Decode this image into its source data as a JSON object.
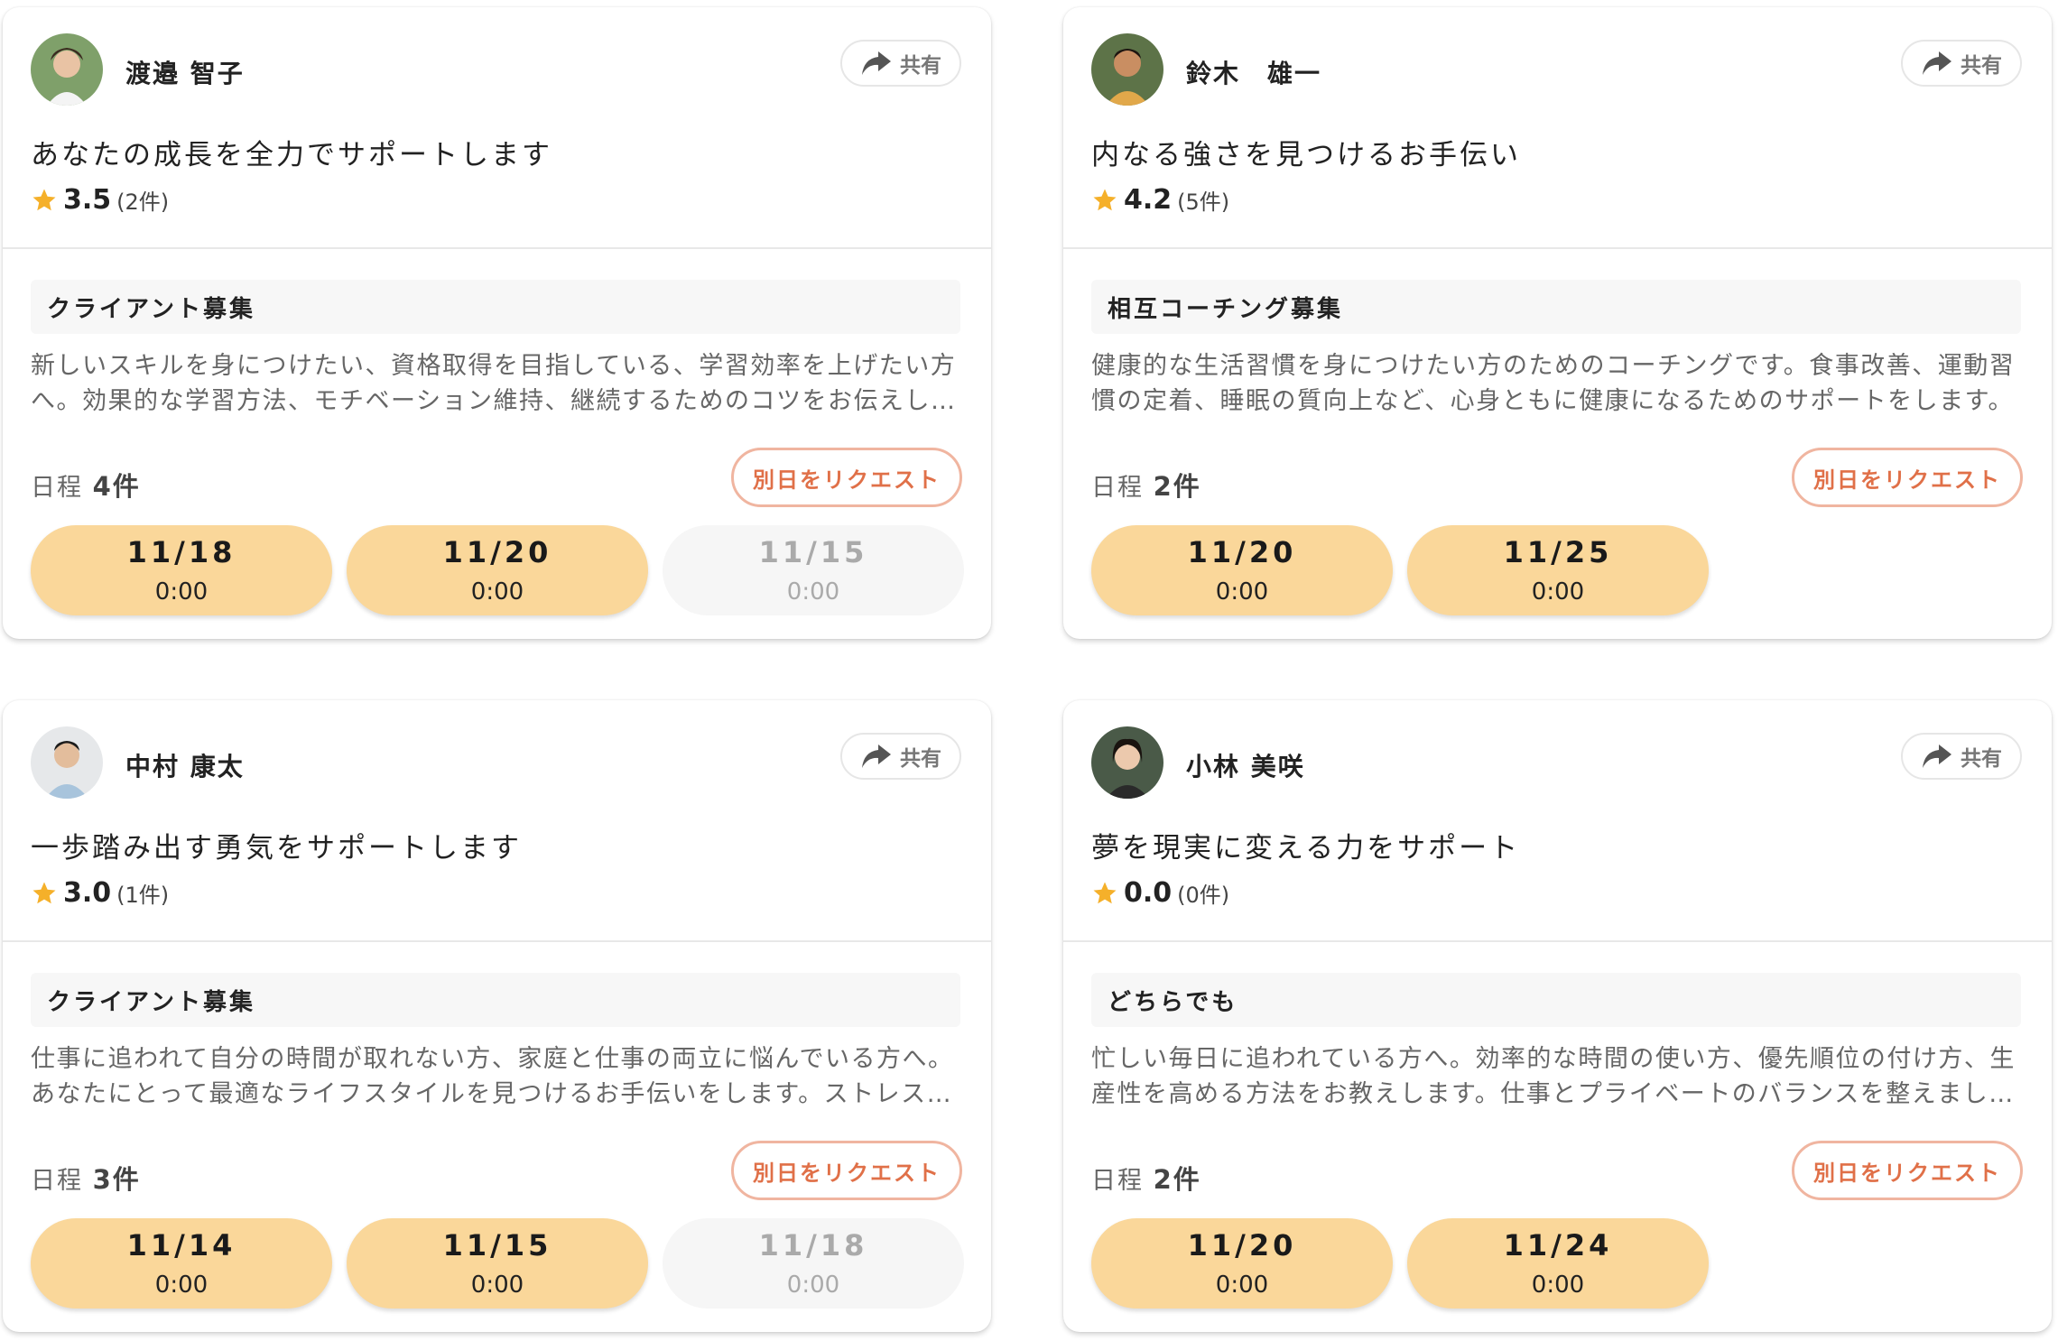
{
  "colors": {
    "slot_bg": "#fad79a",
    "slot_disabled_bg": "#f6f6f6",
    "request_accent": "#e07048",
    "star": "#f5b02a"
  },
  "cards": [
    {
      "name": "渡邉 智子",
      "share_label": "共有",
      "title": "あなたの成長を全力でサポートします",
      "rating": "3.5",
      "review_count": "(2件)",
      "category": "クライアント募集",
      "description": "新しいスキルを身につけたい、資格取得を目指している、学習効率を上げたい方へ。効果的な学習方法、モチベーション維持、継続するためのコツをお伝えします。",
      "schedule_prefix": "日程",
      "schedule_count": "4件",
      "request_label": "別日をリクエスト",
      "slots": [
        {
          "date": "11/18",
          "time": "0:00",
          "available": true
        },
        {
          "date": "11/20",
          "time": "0:00",
          "available": true
        },
        {
          "date": "11/15",
          "time": "0:00",
          "available": false
        }
      ]
    },
    {
      "name": "鈴木　雄一",
      "share_label": "共有",
      "title": "内なる強さを見つけるお手伝い",
      "rating": "4.2",
      "review_count": "(5件)",
      "category": "相互コーチング募集",
      "description": "健康的な生活習慣を身につけたい方のためのコーチングです。食事改善、運動習慣の定着、睡眠の質向上など、心身ともに健康になるためのサポートをします。",
      "schedule_prefix": "日程",
      "schedule_count": "2件",
      "request_label": "別日をリクエスト",
      "slots": [
        {
          "date": "11/20",
          "time": "0:00",
          "available": true
        },
        {
          "date": "11/25",
          "time": "0:00",
          "available": true
        }
      ]
    },
    {
      "name": "中村 康太",
      "share_label": "共有",
      "title": "一歩踏み出す勇気をサポートします",
      "rating": "3.0",
      "review_count": "(1件)",
      "category": "クライアント募集",
      "description": "仕事に追われて自分の時間が取れない方、家庭と仕事の両立に悩んでいる方へ。あなたにとって最適なライフスタイルを見つけるお手伝いをします。ストレスなく",
      "schedule_prefix": "日程",
      "schedule_count": "3件",
      "request_label": "別日をリクエスト",
      "slots": [
        {
          "date": "11/14",
          "time": "0:00",
          "available": true
        },
        {
          "date": "11/15",
          "time": "0:00",
          "available": true
        },
        {
          "date": "11/18",
          "time": "0:00",
          "available": false
        }
      ]
    },
    {
      "name": "小林 美咲",
      "share_label": "共有",
      "title": "夢を現実に変える力をサポート",
      "rating": "0.0",
      "review_count": "(0件)",
      "category": "どちらでも",
      "description": "忙しい毎日に追われている方へ。効率的な時間の使い方、優先順位の付け方、生産性を高める方法をお教えします。仕事とプライベートのバランスを整えましょう。",
      "schedule_prefix": "日程",
      "schedule_count": "2件",
      "request_label": "別日をリクエスト",
      "slots": [
        {
          "date": "11/20",
          "time": "0:00",
          "available": true
        },
        {
          "date": "11/24",
          "time": "0:00",
          "available": true
        }
      ]
    }
  ]
}
